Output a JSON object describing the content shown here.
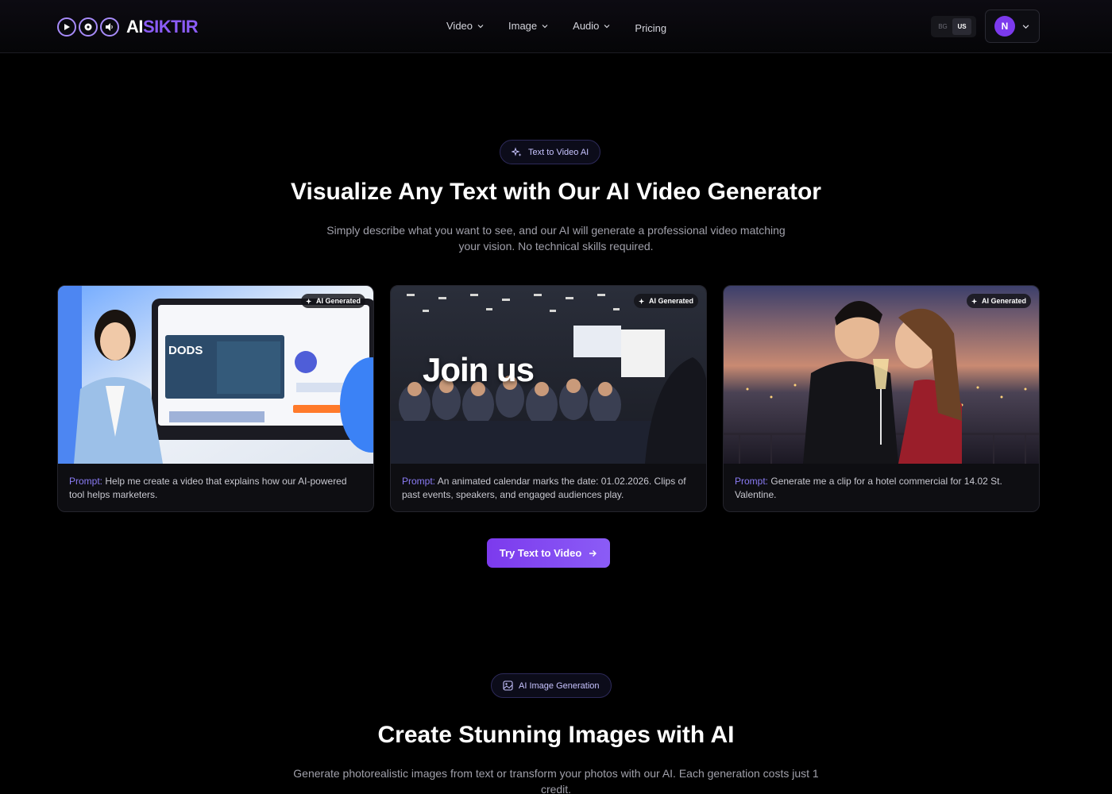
{
  "nav": {
    "logo_ai": "AI",
    "logo_brand": "SIKTIR",
    "links": [
      "Video",
      "Image",
      "Audio"
    ],
    "pricing": "Pricing",
    "lang": [
      "BG",
      "US"
    ],
    "user_initial": "N"
  },
  "section1": {
    "pill": "Text to Video AI",
    "title": "Visualize Any Text with Our AI Video Generator",
    "subtitle": "Simply describe what you want to see, and our AI will generate a professional video matching your vision. No technical skills required.",
    "cards": [
      {
        "badge": "AI Generated",
        "prompt_label": "Prompt:",
        "prompt": "Help me create a video that explains how our AI-powered tool helps marketers."
      },
      {
        "badge": "AI Generated",
        "prompt_label": "Prompt:",
        "prompt": "An animated calendar marks the date: 01.02.2026. Clips of past events, speakers, and engaged audiences play.",
        "overlay": "Join us"
      },
      {
        "badge": "AI Generated",
        "prompt_label": "Prompt:",
        "prompt": "Generate me a clip for a hotel commercial for 14.02 St. Valentine."
      }
    ],
    "cta": "Try Text to Video"
  },
  "section2": {
    "pill": "AI Image Generation",
    "title": "Create Stunning Images with AI",
    "subtitle": "Generate photorealistic images from text or transform your photos with our AI. Each generation costs just 1 credit."
  },
  "colors": {
    "accent": "#8b5cf6",
    "background": "#000000"
  }
}
